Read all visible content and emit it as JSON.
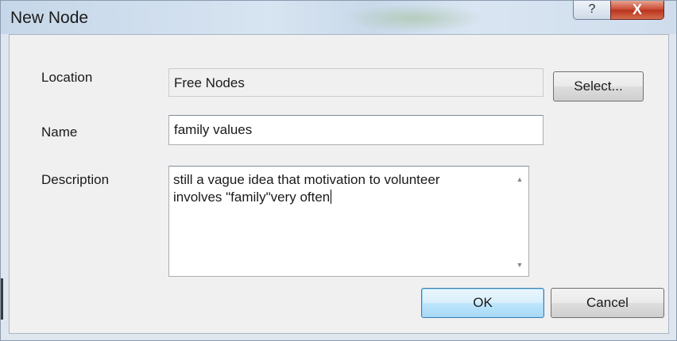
{
  "window": {
    "title": "New Node",
    "help_glyph": "?",
    "close_glyph": "X"
  },
  "form": {
    "location_label": "Location",
    "location_value": "Free Nodes",
    "select_button": "Select...",
    "name_label": "Name",
    "name_value": "family values",
    "description_label": "Description",
    "description_value": "still a vague idea that motivation to volunteer\ninvolves \"family\"very often"
  },
  "buttons": {
    "ok": "OK",
    "cancel": "Cancel"
  },
  "icons": {
    "scroll_up": "up-arrow-icon",
    "scroll_down": "down-arrow-icon"
  }
}
